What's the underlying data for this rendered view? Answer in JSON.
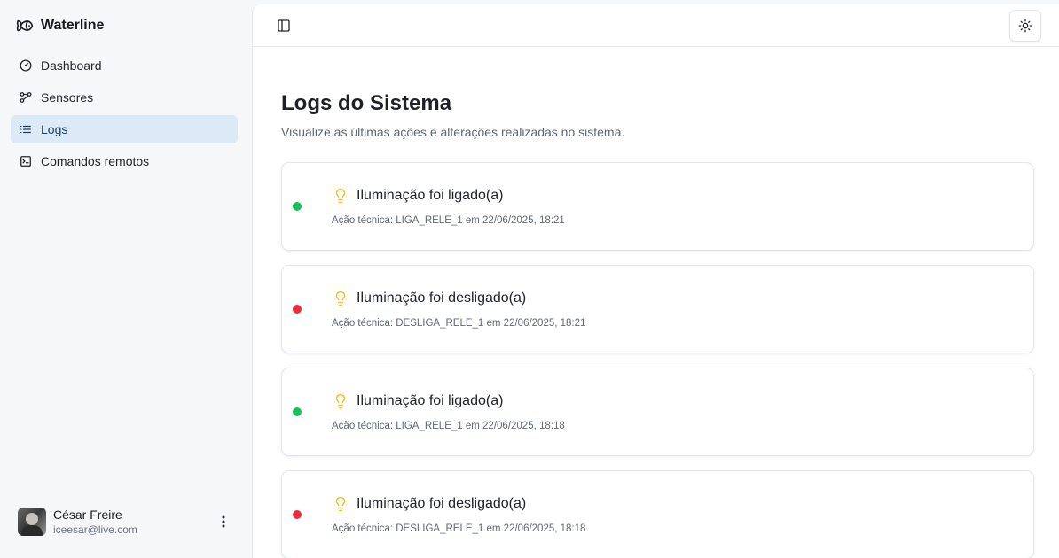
{
  "brand": {
    "name": "Waterline",
    "icon": "fish-icon"
  },
  "nav": {
    "items": [
      {
        "label": "Dashboard",
        "icon": "gauge-icon",
        "active": false
      },
      {
        "label": "Sensores",
        "icon": "workflow-icon",
        "active": false
      },
      {
        "label": "Logs",
        "icon": "list-icon",
        "active": true
      },
      {
        "label": "Comandos remotos",
        "icon": "terminal-icon",
        "active": false
      }
    ]
  },
  "user": {
    "name": "César Freire",
    "email": "iceesar@live.com"
  },
  "topbar": {
    "sidebar_toggle_icon": "sidebar-toggle-icon",
    "theme_icon": "sun-icon"
  },
  "page": {
    "title": "Logs do Sistema",
    "subtitle": "Visualize as últimas ações e alterações realizadas no sistema."
  },
  "logs": [
    {
      "title": "Iluminação foi ligado(a)",
      "detail": "Ação técnica: LIGA_RELE_1 em 22/06/2025, 18:21",
      "status": "on"
    },
    {
      "title": "Iluminação foi desligado(a)",
      "detail": "Ação técnica: DESLIGA_RELE_1 em 22/06/2025, 18:21",
      "status": "off"
    },
    {
      "title": "Iluminação foi ligado(a)",
      "detail": "Ação técnica: LIGA_RELE_1 em 22/06/2025, 18:18",
      "status": "on"
    },
    {
      "title": "Iluminação foi desligado(a)",
      "detail": "Ação técnica: DESLIGA_RELE_1 em 22/06/2025, 18:18",
      "status": "off"
    }
  ],
  "colors": {
    "on": "#16c15a",
    "off": "#ef2d3a",
    "bulb": "#f4c21a",
    "active_nav_bg": "#dceaf7"
  }
}
